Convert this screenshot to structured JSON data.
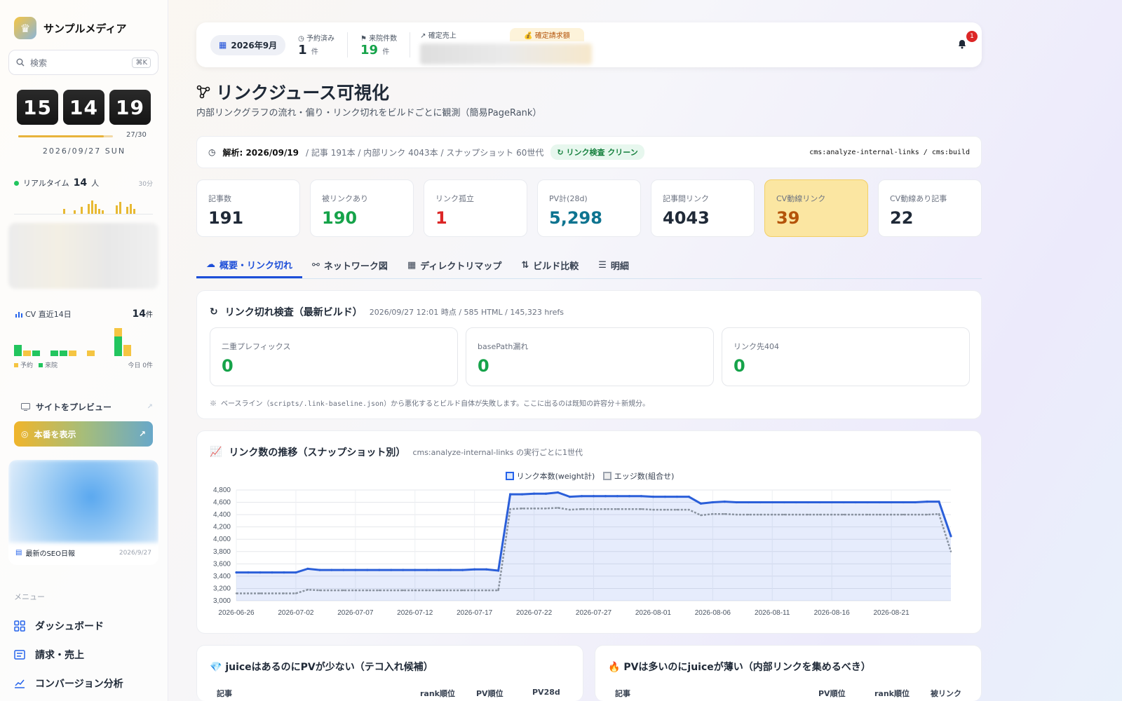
{
  "sidebar": {
    "brand": "サンプルメディア",
    "search_placeholder": "検索",
    "search_shortcut": "⌘K",
    "clock": {
      "h": "15",
      "m": "14",
      "s": "19"
    },
    "progress": {
      "label": "27/30",
      "fraction": 0.9
    },
    "date": "2026/09/27 SUN",
    "realtime": {
      "label": "リアルタイム",
      "count": "14",
      "unit": "人",
      "window": "30分",
      "bars": [
        0,
        0,
        0,
        0,
        0,
        0,
        0,
        0,
        0,
        0,
        0,
        0,
        0,
        0,
        3,
        0,
        0,
        2,
        0,
        4,
        0,
        6,
        8,
        6,
        3,
        2,
        0,
        0,
        0,
        5,
        7,
        0,
        4,
        6,
        3,
        0,
        0,
        0,
        0,
        0
      ]
    },
    "cv": {
      "label": "CV 直近14日",
      "count": "14",
      "unit": "件",
      "days": [
        [
          0,
          4
        ],
        [
          2,
          0
        ],
        [
          0,
          2
        ],
        [
          0,
          0
        ],
        [
          0,
          2
        ],
        [
          0,
          2
        ],
        [
          2,
          0
        ],
        [
          0,
          0
        ],
        [
          2,
          0
        ],
        [
          0,
          0
        ],
        [
          0,
          0
        ],
        [
          3,
          7
        ],
        [
          4,
          0
        ],
        [
          0,
          0
        ]
      ],
      "legend_reserve": "予約",
      "legend_visit": "来院",
      "today": "今日 0件"
    },
    "preview": "サイトをプレビュー",
    "production": "本番を表示",
    "seo": {
      "title": "最新のSEO日報",
      "date": "2026/9/27"
    },
    "menu_title": "メニュー",
    "menu": [
      {
        "label": "ダッシュボード",
        "icon": "grid-icon"
      },
      {
        "label": "請求・売上",
        "icon": "invoice-icon"
      },
      {
        "label": "コンバージョン分析",
        "icon": "chart-icon"
      }
    ]
  },
  "topbar": {
    "month": "2026年9月",
    "reserved": {
      "label": "予約済み",
      "value": "1",
      "unit": "件"
    },
    "visits": {
      "label": "来院件数",
      "value": "19",
      "unit": "件"
    },
    "sales_label": "確定売上",
    "billing_label": "確定請求額",
    "notifications": "1"
  },
  "page": {
    "title": "リンクジュース可視化",
    "subtitle": "内部リンクグラフの流れ・偏り・リンク切れをビルドごとに観測（簡易PageRank）"
  },
  "info": {
    "analysis_label": "解析: 2026/09/19",
    "stats": "/ 記事 191本 / 内部リンク 4043本 / スナップショット 60世代",
    "status": "リンク検査 クリーン",
    "command": "cms:analyze-internal-links / cms:build"
  },
  "kpis": [
    {
      "label": "記事数",
      "value": "191",
      "color": "#1f2937"
    },
    {
      "label": "被リンクあり",
      "value": "190",
      "color": "#16a34a"
    },
    {
      "label": "リンク孤立",
      "value": "1",
      "color": "#dc2626"
    },
    {
      "label": "PV計(28d)",
      "value": "5,298",
      "color": "#0e7490"
    },
    {
      "label": "記事間リンク",
      "value": "4043",
      "color": "#1f2937"
    },
    {
      "label": "CV動線リンク",
      "value": "39",
      "color": "#b45309"
    },
    {
      "label": "CV動線あり記事",
      "value": "22",
      "color": "#1f2937"
    }
  ],
  "tabs": [
    "概要・リンク切れ",
    "ネットワーク図",
    "ディレクトリマップ",
    "ビルド比較",
    "明細"
  ],
  "linkcheck": {
    "title": "リンク切れ検査（最新ビルド）",
    "meta": "2026/09/27 12:01 時点 / 585 HTML / 145,323 hrefs",
    "cards": [
      {
        "label": "二重プレフィックス",
        "value": "0"
      },
      {
        "label": "basePath漏れ",
        "value": "0"
      },
      {
        "label": "リンク先404",
        "value": "0"
      }
    ],
    "note": "※ ベースライン（scripts/.link-baseline.json）から悪化するとビルド自体が失敗します。ここに出るのは既知の許容分＋新規分。"
  },
  "trend": {
    "title": "リンク数の推移（スナップショット別）",
    "meta": "cms:analyze-internal-links の実行ごとに1世代"
  },
  "chart_data": {
    "type": "line",
    "series": [
      {
        "name": "リンク本数(weight計)",
        "color": "#2b5fd9",
        "values": [
          3460,
          3460,
          3460,
          3460,
          3460,
          3460,
          3520,
          3500,
          3500,
          3500,
          3500,
          3500,
          3500,
          3500,
          3500,
          3500,
          3500,
          3500,
          3500,
          3500,
          3510,
          3510,
          3490,
          4730,
          4730,
          4740,
          4740,
          4760,
          4690,
          4700,
          4700,
          4700,
          4700,
          4700,
          4700,
          4690,
          4690,
          4690,
          4690,
          4580,
          4600,
          4610,
          4600,
          4600,
          4600,
          4600,
          4600,
          4600,
          4600,
          4600,
          4600,
          4600,
          4600,
          4600,
          4600,
          4600,
          4600,
          4600,
          4610,
          4610,
          4050
        ]
      },
      {
        "name": "エッジ数(組合せ)",
        "color": "#8a93a0",
        "values": [
          3120,
          3120,
          3120,
          3120,
          3120,
          3120,
          3180,
          3170,
          3170,
          3170,
          3170,
          3170,
          3170,
          3170,
          3170,
          3170,
          3170,
          3170,
          3170,
          3170,
          3170,
          3170,
          3170,
          4490,
          4500,
          4500,
          4500,
          4510,
          4480,
          4490,
          4490,
          4490,
          4490,
          4490,
          4490,
          4480,
          4480,
          4480,
          4480,
          4390,
          4410,
          4410,
          4400,
          4400,
          4400,
          4400,
          4400,
          4400,
          4400,
          4400,
          4400,
          4400,
          4400,
          4400,
          4400,
          4400,
          4400,
          4400,
          4400,
          4410,
          3800
        ]
      }
    ],
    "x_ticks": [
      "2026-06-26",
      "2026-07-02",
      "2026-07-07",
      "2026-07-12",
      "2026-07-17",
      "2026-07-22",
      "2026-07-27",
      "2026-08-01",
      "2026-08-06",
      "2026-08-11",
      "2026-08-16",
      "2026-08-21"
    ],
    "y_ticks": [
      "3,000",
      "3,200",
      "3,400",
      "3,600",
      "3,800",
      "4,000",
      "4,200",
      "4,400",
      "4,600",
      "4,800"
    ],
    "ylim": [
      3000,
      4800
    ],
    "grid": true,
    "legend": "top-center"
  },
  "bottom": {
    "left": {
      "title": "juiceはあるのにPVが少ない（テコ入れ候補）",
      "cols": [
        "記事",
        "rank順位",
        "PV順位",
        "PV28d"
      ]
    },
    "right": {
      "title": "PVは多いのにjuiceが薄い（内部リンクを集めるべき）",
      "cols": [
        "記事",
        "PV順位",
        "rank順位",
        "被リンク"
      ]
    }
  }
}
